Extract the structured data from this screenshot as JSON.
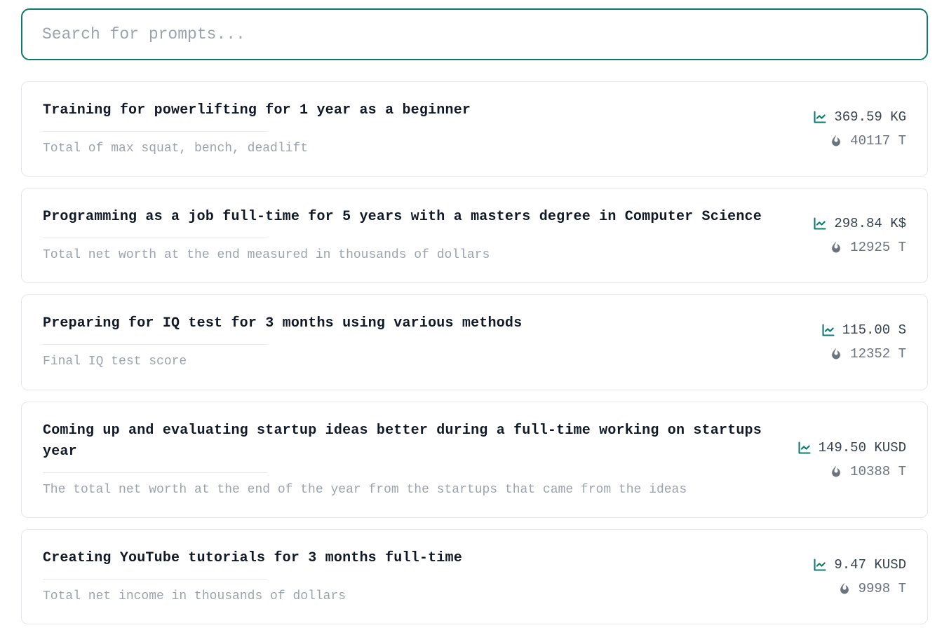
{
  "search": {
    "placeholder": "Search for prompts...",
    "value": ""
  },
  "items": [
    {
      "title": "Training for powerlifting for 1 year as a beginner",
      "subtitle": "Total of max squat, bench, deadlift",
      "chart": "369.59 KG",
      "fire": "40117 T"
    },
    {
      "title": "Programming as a job full-time for 5 years with a masters degree in Computer Science",
      "subtitle": "Total net worth at the end measured in thousands of dollars",
      "chart": "298.84 K$",
      "fire": "12925 T"
    },
    {
      "title": "Preparing for IQ test for 3 months using various methods",
      "subtitle": "Final IQ test score",
      "chart": "115.00 S",
      "fire": "12352 T"
    },
    {
      "title": "Coming up and evaluating startup ideas better during a full-time working on startups year",
      "subtitle": "The total net worth at the end of the year from the startups that came from the ideas",
      "chart": "149.50 KUSD",
      "fire": "10388 T"
    },
    {
      "title": "Creating YouTube tutorials for 3 months full-time",
      "subtitle": "Total net income in thousands of dollars",
      "chart": "9.47 KUSD",
      "fire": "9998 T"
    }
  ]
}
